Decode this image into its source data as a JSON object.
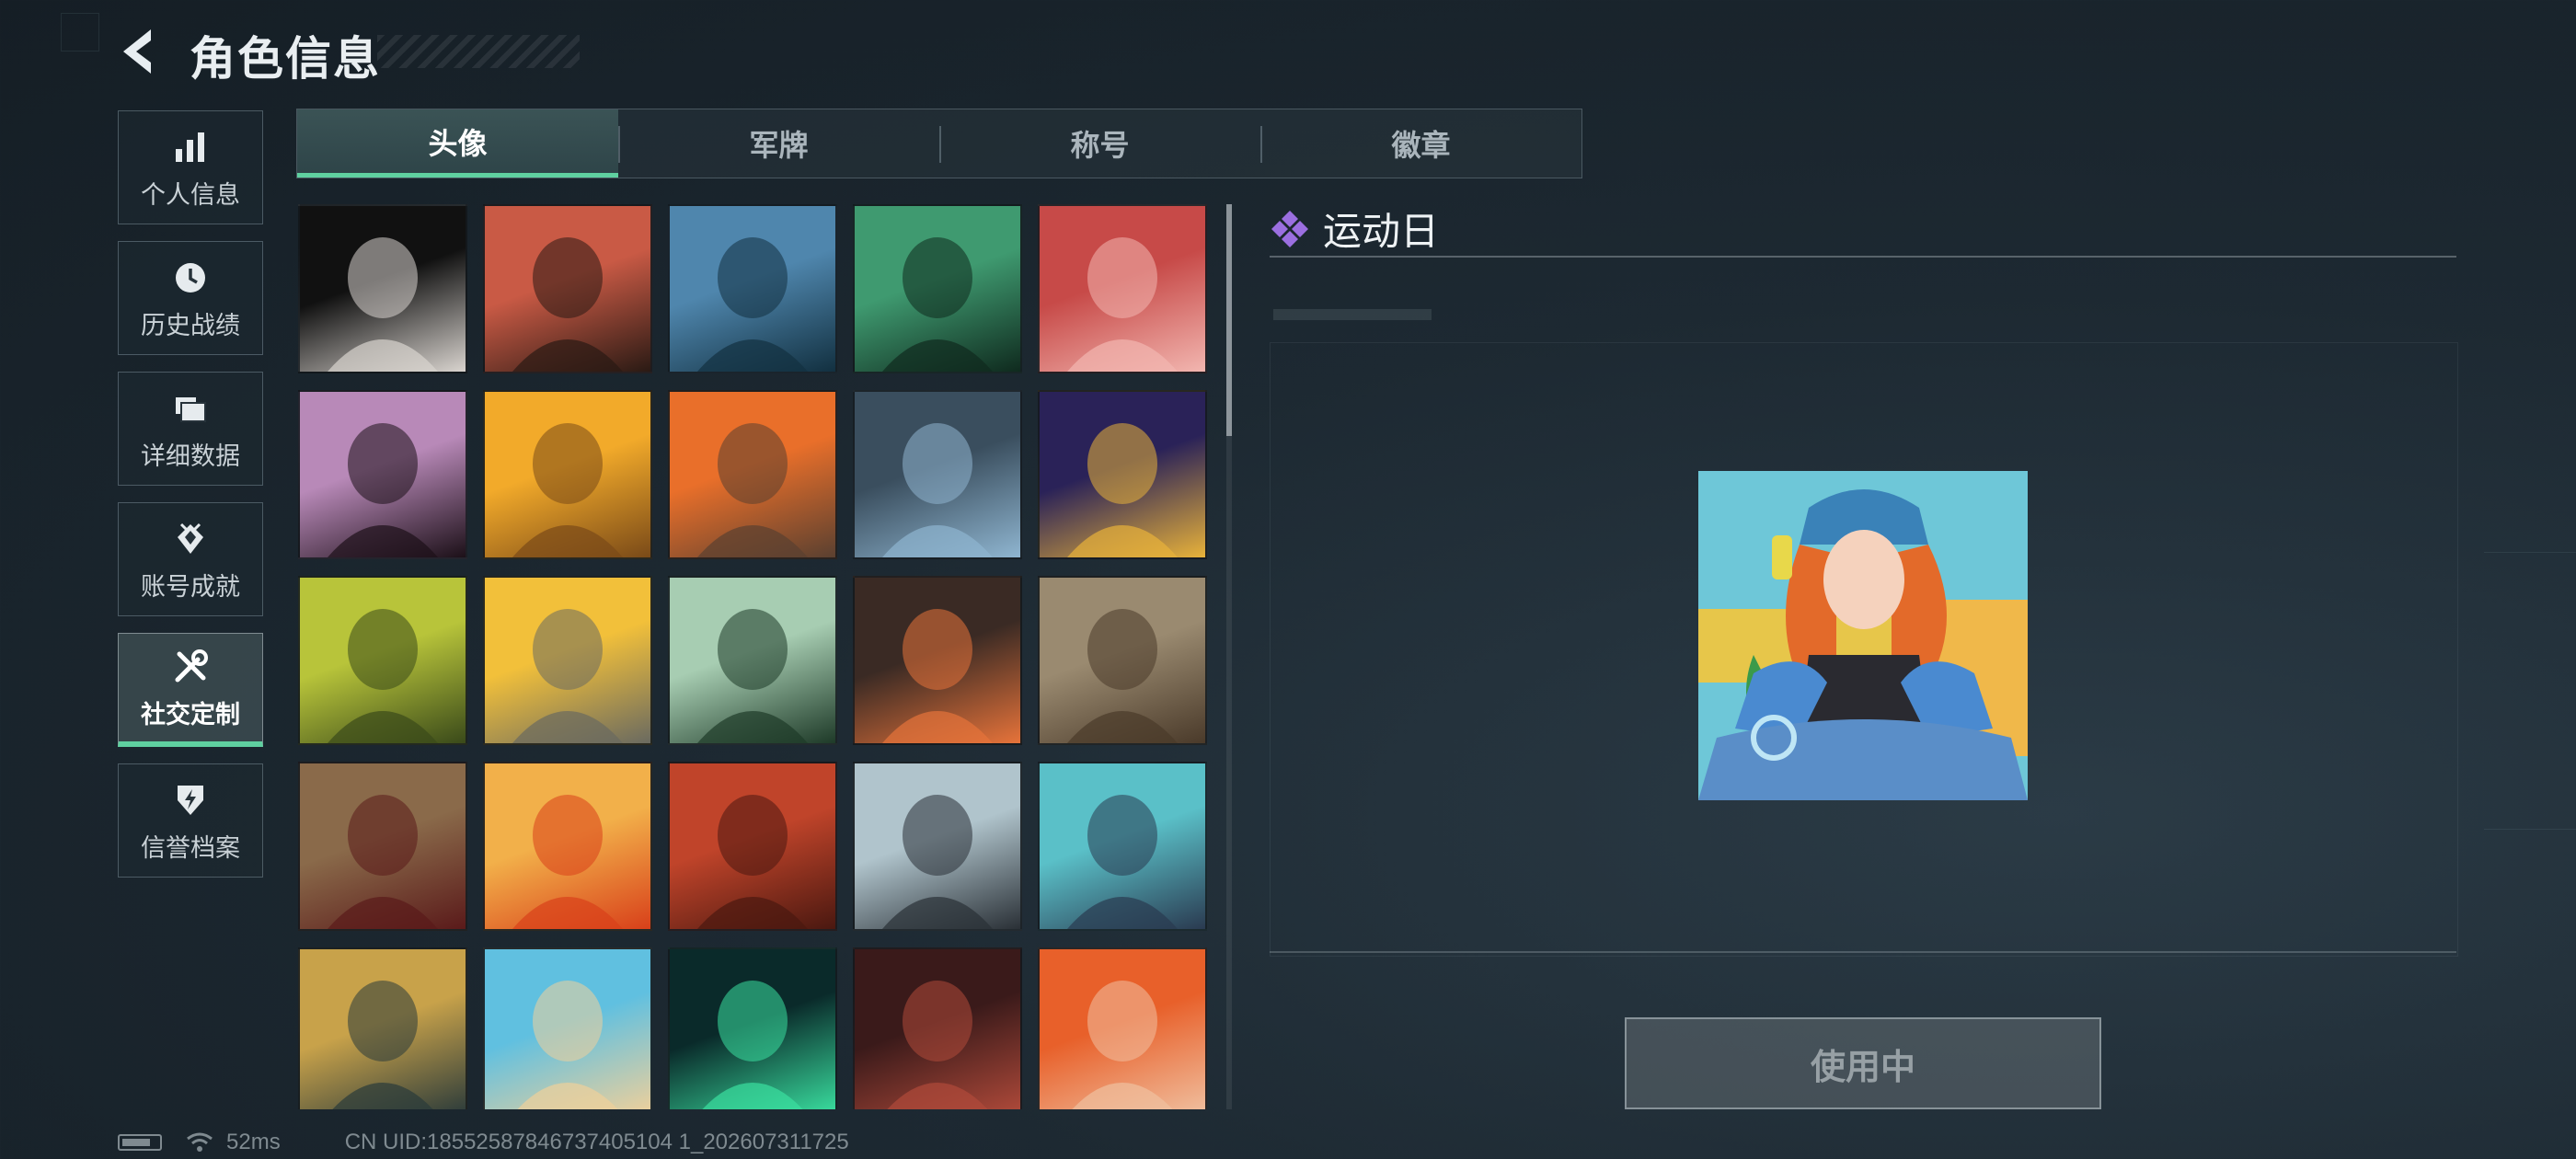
{
  "header": {
    "title": "角色信息"
  },
  "sidebar": {
    "items": [
      {
        "label": "个人信息",
        "icon": "bar-chart-icon",
        "active": false
      },
      {
        "label": "历史战绩",
        "icon": "history-clock-icon",
        "active": false
      },
      {
        "label": "详细数据",
        "icon": "folder-icon",
        "active": false
      },
      {
        "label": "账号成就",
        "icon": "achievement-icon",
        "active": false
      },
      {
        "label": "社交定制",
        "icon": "tools-icon",
        "active": true
      },
      {
        "label": "信誉档案",
        "icon": "credit-badge-icon",
        "active": false
      }
    ]
  },
  "tabs": [
    {
      "label": "头像",
      "active": true
    },
    {
      "label": "军牌",
      "active": false
    },
    {
      "label": "称号",
      "active": false
    },
    {
      "label": "徽章",
      "active": false
    }
  ],
  "avatars": [
    {
      "name": "gothic-doll",
      "c1": "#111111",
      "c2": "#d9d4cf",
      "selected": false
    },
    {
      "name": "bearded-soldier",
      "c1": "#c95a45",
      "c2": "#2a1a14",
      "selected": false
    },
    {
      "name": "pilot",
      "c1": "#4f86ad",
      "c2": "#123040",
      "selected": false
    },
    {
      "name": "headset-operator",
      "c1": "#3f9a70",
      "c2": "#0f2a1e",
      "selected": false
    },
    {
      "name": "red-helmet",
      "c1": "#c74a48",
      "c2": "#f2b6b0",
      "selected": false
    },
    {
      "name": "pink-hair-girl",
      "c1": "#b889b8",
      "c2": "#1c1018",
      "selected": false
    },
    {
      "name": "chocolate-triangle",
      "c1": "#f2aa2a",
      "c2": "#7a4a18",
      "selected": false
    },
    {
      "name": "soldier-plane",
      "c1": "#e96f2a",
      "c2": "#5a4030",
      "selected": false
    },
    {
      "name": "sniper-scope",
      "c1": "#3a4e5e",
      "c2": "#8fb5d0",
      "selected": false
    },
    {
      "name": "golden-book",
      "c1": "#2a2258",
      "c2": "#e8b23a",
      "selected": false
    },
    {
      "name": "exit-door",
      "c1": "#b8c43a",
      "c2": "#3a4a1a",
      "selected": false
    },
    {
      "name": "stone-creature",
      "c1": "#f2c03a",
      "c2": "#6a6a60",
      "selected": false
    },
    {
      "name": "way-out-sign",
      "c1": "#a7cdb2",
      "c2": "#1e3a28",
      "selected": false
    },
    {
      "name": "orange-feather",
      "c1": "#3a2a24",
      "c2": "#e6733a",
      "selected": false
    },
    {
      "name": "rusty-truck",
      "c1": "#9a8a70",
      "c2": "#4a3a2a",
      "selected": false
    },
    {
      "name": "scales-emblem",
      "c1": "#8a6a4a",
      "c2": "#5a1a1a",
      "selected": false
    },
    {
      "name": "chili-fries",
      "c1": "#f2b04a",
      "c2": "#d8401a",
      "selected": false
    },
    {
      "name": "red-hair-woman",
      "c1": "#c0442a",
      "c2": "#4a1810",
      "selected": false
    },
    {
      "name": "mountain-peak",
      "c1": "#b0c4cc",
      "c2": "#2a3036",
      "selected": false
    },
    {
      "name": "music-lounge",
      "c1": "#5ac0c8",
      "c2": "#2a3a50",
      "selected": false
    },
    {
      "name": "alligator-sign",
      "c1": "#c8a24a",
      "c2": "#2a3a3a",
      "selected": false
    },
    {
      "name": "cat-medal",
      "c1": "#60c0e0",
      "c2": "#f0d09a",
      "selected": false
    },
    {
      "name": "neon-logo",
      "c1": "#0a2a2a",
      "c2": "#3ae0a0",
      "selected": false
    },
    {
      "name": "goggles-pirate",
      "c1": "#3a1a1a",
      "c2": "#b04a3a",
      "selected": false
    },
    {
      "name": "monkey-reader",
      "c1": "#e8602a",
      "c2": "#f0c0a0",
      "selected": false
    }
  ],
  "detail": {
    "name": "运动日",
    "rarity_color": "#9b6fe0",
    "button_label": "使用中"
  },
  "status": {
    "ping": "52ms",
    "uid": "CN UID:18552587846737405104 1_202607311725"
  }
}
